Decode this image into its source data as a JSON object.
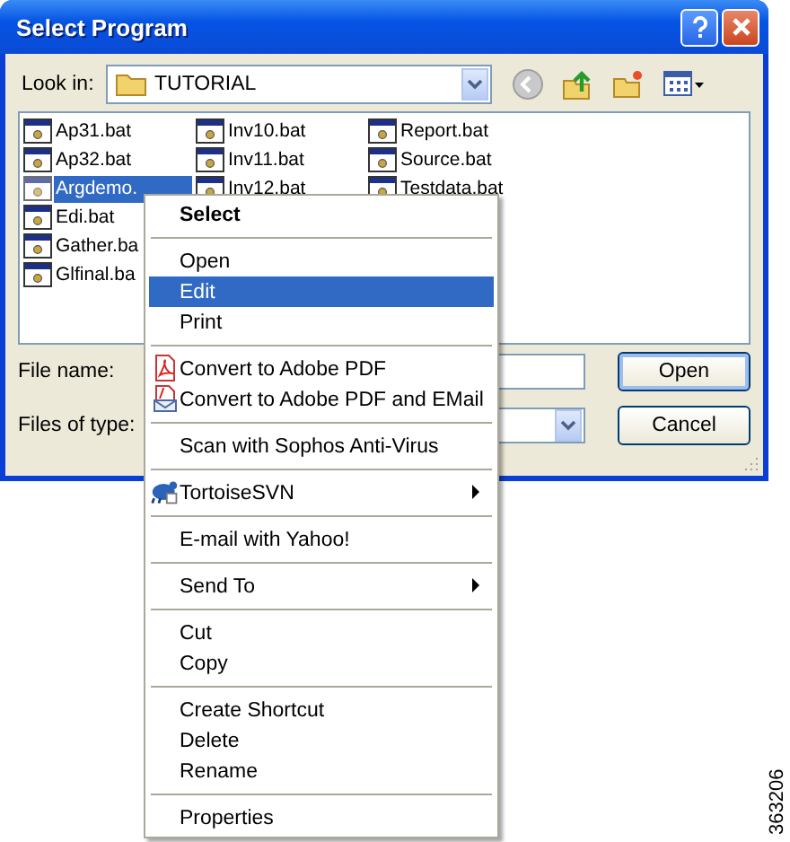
{
  "window": {
    "title": "Select Program"
  },
  "look_in": {
    "label": "Look in:",
    "value": "TUTORIAL"
  },
  "file_columns": [
    [
      {
        "name": "Ap31.bat",
        "selected": false
      },
      {
        "name": "Ap32.bat",
        "selected": false
      },
      {
        "name": "Argdemo.",
        "selected": true
      },
      {
        "name": "Edi.bat",
        "selected": false
      },
      {
        "name": "Gather.ba",
        "selected": false
      },
      {
        "name": "Glfinal.ba",
        "selected": false
      }
    ],
    [
      {
        "name": "Inv10.bat",
        "selected": false
      },
      {
        "name": "Inv11.bat",
        "selected": false
      },
      {
        "name": "Inv12.bat",
        "selected": false
      }
    ],
    [
      {
        "name": "Report.bat",
        "selected": false
      },
      {
        "name": "Source.bat",
        "selected": false
      },
      {
        "name": "Testdata.bat",
        "selected": false
      }
    ]
  ],
  "file_name": {
    "label": "File name:"
  },
  "files_of_type": {
    "label": "Files of type:"
  },
  "buttons": [
    {
      "label": "Open",
      "default": true
    },
    {
      "label": "Cancel",
      "default": false
    }
  ],
  "context_menu": [
    {
      "kind": "item",
      "label": "Select",
      "default": true,
      "selected": false
    },
    {
      "kind": "separator"
    },
    {
      "kind": "item",
      "label": "Open",
      "selected": false
    },
    {
      "kind": "item",
      "label": "Edit",
      "selected": true
    },
    {
      "kind": "item",
      "label": "Print",
      "selected": false
    },
    {
      "kind": "separator"
    },
    {
      "kind": "item",
      "label": "Convert to Adobe PDF",
      "icon": true,
      "selected": false
    },
    {
      "kind": "item",
      "label": "Convert to Adobe PDF and EMail",
      "icon": true,
      "selected": false
    },
    {
      "kind": "separator"
    },
    {
      "kind": "item",
      "label": "Scan with Sophos Anti-Virus",
      "selected": false
    },
    {
      "kind": "separator"
    },
    {
      "kind": "item",
      "label": "TortoiseSVN",
      "icon": true,
      "submenu": true,
      "selected": false
    },
    {
      "kind": "separator"
    },
    {
      "kind": "item",
      "label": "E-mail with Yahoo!",
      "selected": false
    },
    {
      "kind": "separator"
    },
    {
      "kind": "item",
      "label": "Send To",
      "submenu": true,
      "selected": false
    },
    {
      "kind": "separator"
    },
    {
      "kind": "item",
      "label": "Cut",
      "selected": false
    },
    {
      "kind": "item",
      "label": "Copy",
      "selected": false
    },
    {
      "kind": "separator"
    },
    {
      "kind": "item",
      "label": "Create Shortcut",
      "selected": false
    },
    {
      "kind": "item",
      "label": "Delete",
      "selected": false
    },
    {
      "kind": "item",
      "label": "Rename",
      "selected": false
    },
    {
      "kind": "separator"
    },
    {
      "kind": "item",
      "label": "Properties",
      "selected": false
    }
  ],
  "figure_id": "363206"
}
